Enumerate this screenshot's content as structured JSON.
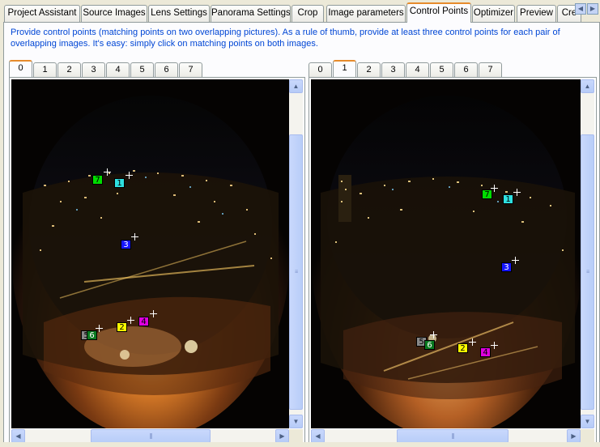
{
  "top_tabs": [
    {
      "label": "Project Assistant",
      "active": false
    },
    {
      "label": "Source Images",
      "active": false
    },
    {
      "label": "Lens Settings",
      "active": false
    },
    {
      "label": "Panorama Settings",
      "active": false
    },
    {
      "label": "Crop",
      "active": false
    },
    {
      "label": "Image parameters",
      "active": false
    },
    {
      "label": "Control Points",
      "active": true
    },
    {
      "label": "Optimizer",
      "active": false
    },
    {
      "label": "Preview",
      "active": false
    },
    {
      "label": "Cre",
      "active": false
    }
  ],
  "tab_scroll": {
    "left_icon": "chevron-left-icon",
    "right_icon": "chevron-right-icon",
    "left_glyph": "◀",
    "right_glyph": "▶"
  },
  "instructions": "Provide control points (matching points on two overlapping pictures). As a rule of thumb, provide at least three control points for each pair of overlapping images. It's easy: simply click on matching points on both images.",
  "left_pane": {
    "image_tabs": [
      "0",
      "1",
      "2",
      "3",
      "4",
      "5",
      "6",
      "7"
    ],
    "selected_index": 0,
    "control_points": [
      "1",
      "3",
      "4",
      "2",
      "6",
      "7",
      "5"
    ]
  },
  "right_pane": {
    "image_tabs": [
      "0",
      "1",
      "2",
      "3",
      "4",
      "5",
      "6",
      "7"
    ],
    "selected_index": 1,
    "control_points": [
      "7",
      "1",
      "3",
      "5",
      "6",
      "2",
      "4"
    ]
  },
  "scroll_glyphs": {
    "up": "▲",
    "down": "▼",
    "left": "◀",
    "right": "▶"
  },
  "colors": {
    "link_text": "#0046d5",
    "active_tab_accent": "#e68b2c",
    "cp_1": "#2ee0e0",
    "cp_2": "#ffff00",
    "cp_3": "#1515ff",
    "cp_4": "#e000e0",
    "cp_5": "#888888",
    "cp_6": "#0a7a20",
    "cp_7": "#00dd00"
  }
}
